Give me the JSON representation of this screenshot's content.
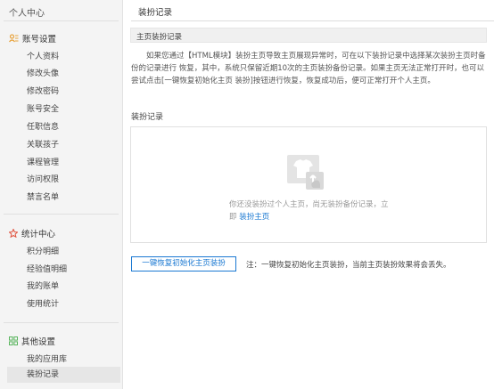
{
  "sidebar": {
    "title": "个人中心",
    "groups": [
      {
        "label": "账号设置",
        "icon": "user-settings-icon",
        "items": [
          "个人资料",
          "修改头像",
          "修改密码",
          "账号安全",
          "任职信息",
          "关联孩子",
          "课程管理",
          "访问权限",
          "禁言名单"
        ]
      },
      {
        "label": "统计中心",
        "icon": "star-icon",
        "items": [
          "积分明细",
          "经验值明细",
          "我的账单",
          "使用统计"
        ]
      },
      {
        "label": "其他设置",
        "icon": "grid-icon",
        "items": [
          "我的应用库",
          "装扮记录"
        ]
      }
    ],
    "active_item": "装扮记录"
  },
  "main": {
    "page_title": "装扮记录",
    "section_title": "主页装扮记录",
    "description": "如果您通过【HTML模块】装扮主页导致主页展现异常时，可在以下装扮记录中选择某次装扮主页时备份的记录进行 恢复，其中，系统只保留近期10次的主页装扮备份记录。如果主页无法正常打开时，也可以尝试点击[一键恢复初始化主页 装扮]按钮进行恢复，恢复成功后，便可正常打开个人主页。",
    "records_label": "装扮记录",
    "empty_text": "你还没装扮过个人主页，尚无装扮备份记录，立即",
    "empty_link": "装扮主页",
    "restore_button": "一键恢复初始化主页装扮",
    "note": "注：一键恢复初始化主页装扮，当前主页装扮效果将会丢失。"
  },
  "colors": {
    "accent": "#1a78d2",
    "orange": "#e8a33d",
    "green": "#5ab55e",
    "red": "#e0533f"
  }
}
